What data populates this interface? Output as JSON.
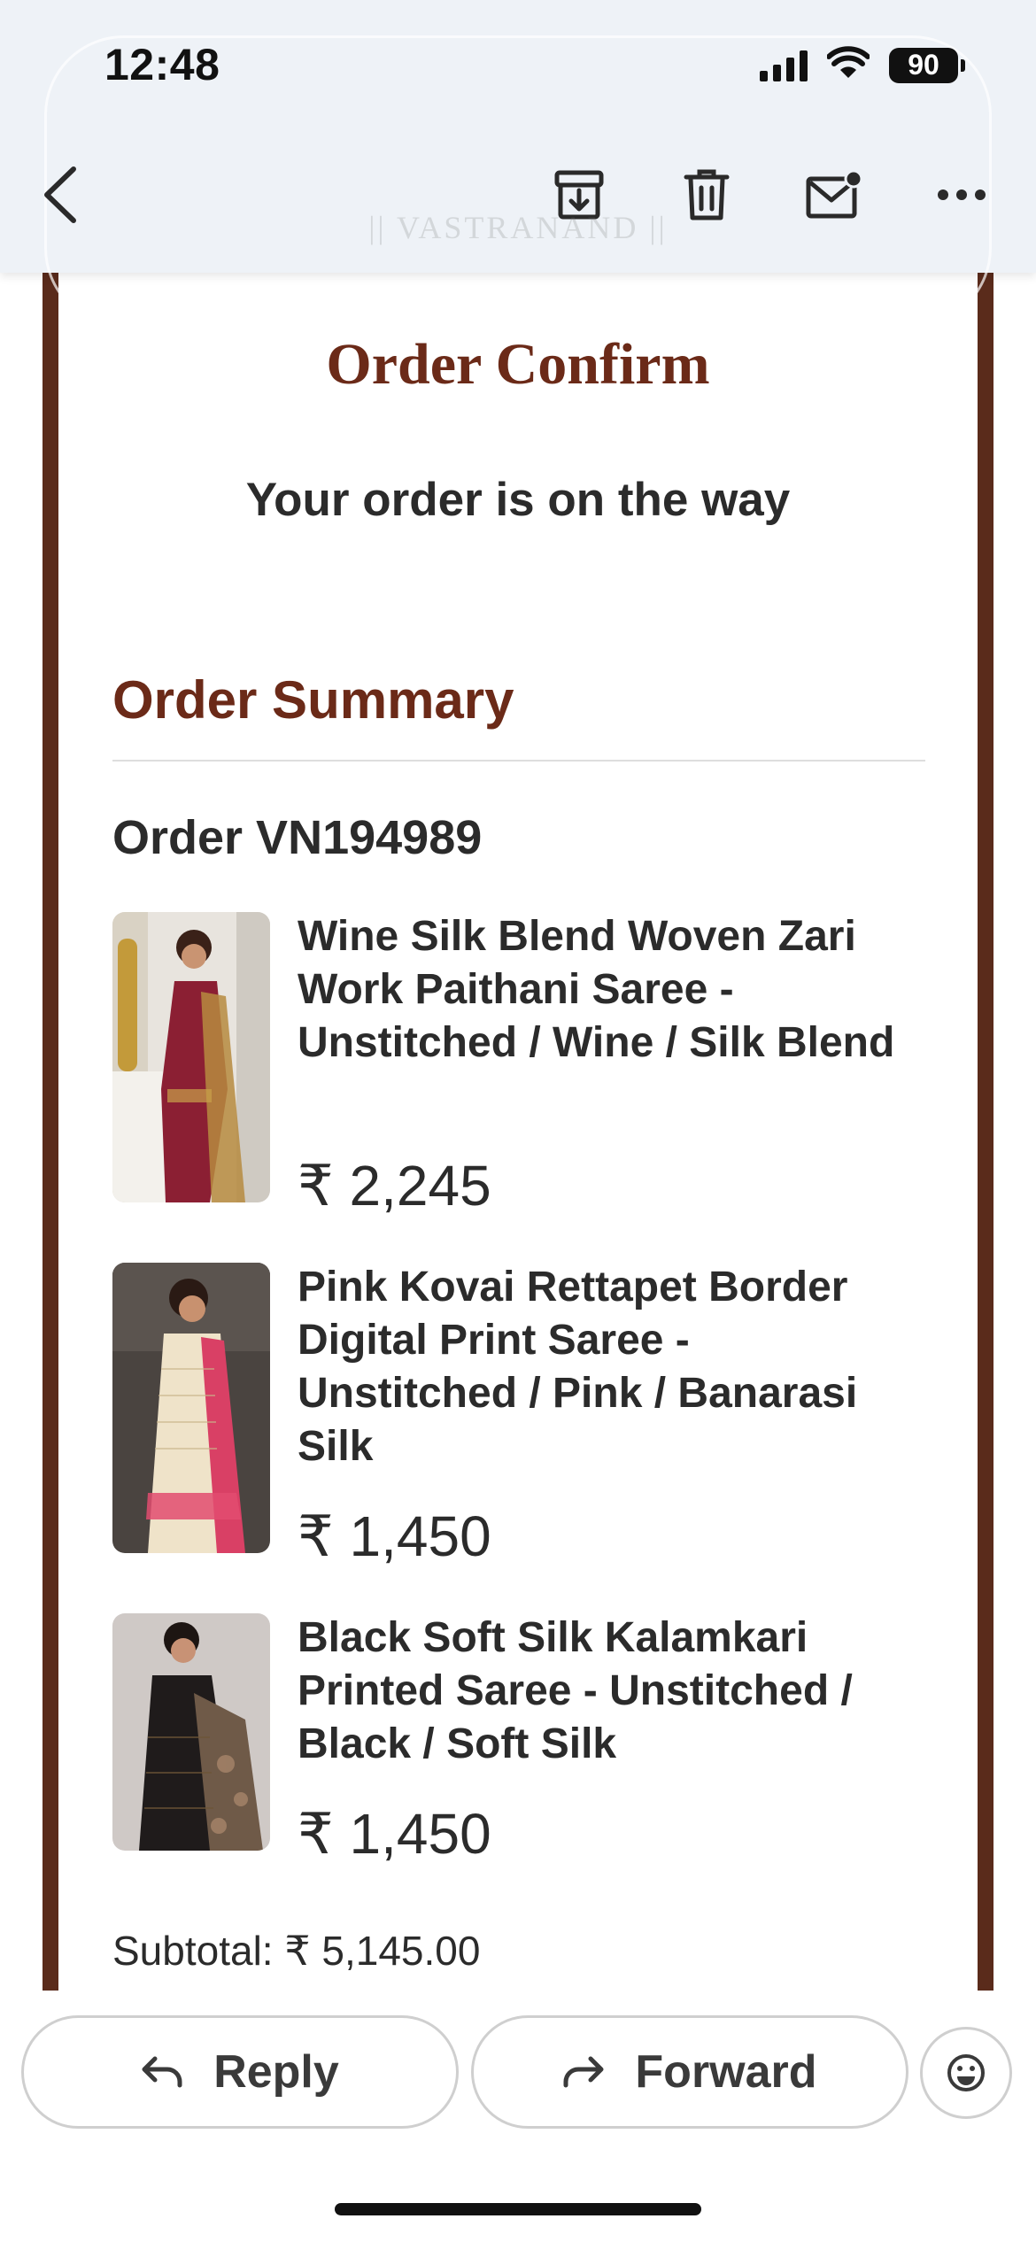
{
  "status_bar": {
    "time": "12:48",
    "battery": "90"
  },
  "toolbar": {
    "icons": [
      "back-chevron-icon",
      "archive-icon",
      "trash-icon",
      "mark-unread-icon",
      "more-icon"
    ]
  },
  "email": {
    "watermark": "|| VASTRANAND ||",
    "title": "Order Confirm",
    "subtitle": "Your order is on the way",
    "summary_heading": "Order Summary",
    "order_number": "Order VN194989",
    "items": [
      {
        "name": "Wine Silk Blend Woven Zari Work Paithani Saree - Unstitched / Wine / Silk Blend",
        "price": "₹ 2,245",
        "thumb_colors": [
          "#8b1f33",
          "#c9a14a"
        ]
      },
      {
        "name": "Pink Kovai Rettapet Border Digital Print Saree - Unstitched / Pink / Banarasi Silk",
        "price": "₹ 1,450",
        "thumb_colors": [
          "#d94065",
          "#efe3c9"
        ]
      },
      {
        "name": "Black Soft Silk Kalamkari Printed Saree - Unstitched / Black / Soft Silk",
        "price": "₹ 1,450",
        "thumb_colors": [
          "#1f1b1b",
          "#8a6a4f"
        ]
      }
    ],
    "subtotal": "Subtotal: ₹ 5,145.00"
  },
  "actions": {
    "reply_label": "Reply",
    "forward_label": "Forward"
  },
  "colors": {
    "brand_brown": "#6b2a18",
    "frame_brown": "#5a2b1b"
  }
}
